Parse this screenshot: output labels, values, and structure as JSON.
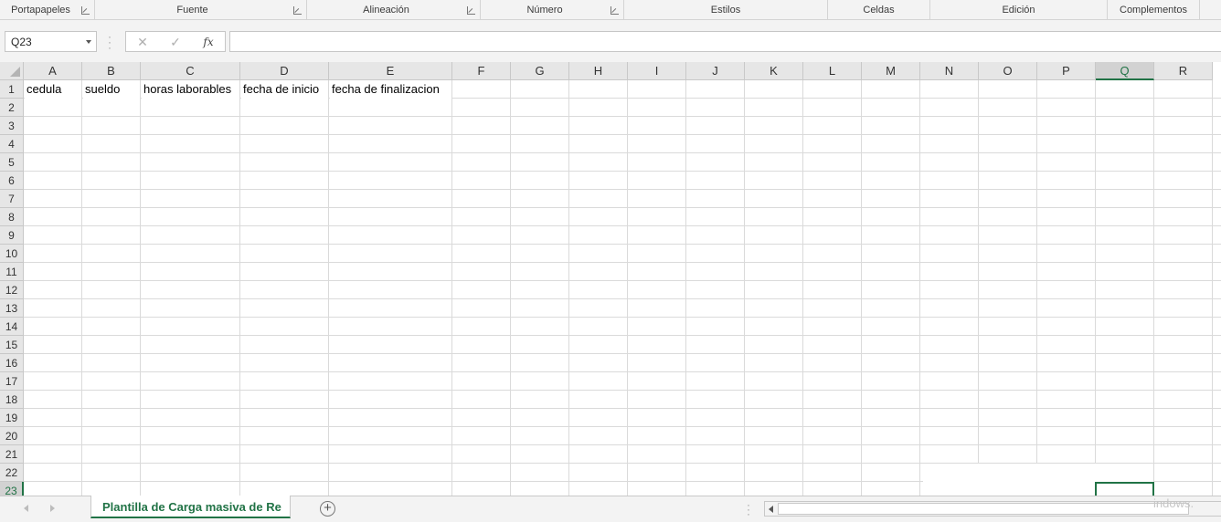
{
  "ribbon": {
    "groups": [
      {
        "label": "Portapapeles",
        "launcher": true
      },
      {
        "label": "Fuente",
        "launcher": true
      },
      {
        "label": "Alineación",
        "launcher": true
      },
      {
        "label": "Número",
        "launcher": true
      },
      {
        "label": "Estilos",
        "launcher": false
      },
      {
        "label": "Celdas",
        "launcher": false
      },
      {
        "label": "Edición",
        "launcher": false
      },
      {
        "label": "Complementos",
        "launcher": false
      }
    ]
  },
  "formula_bar": {
    "name_box": "Q23",
    "cancel_icon": "✕",
    "enter_icon": "✓",
    "fx_label": "fx",
    "formula": ""
  },
  "grid": {
    "columns": [
      "A",
      "B",
      "C",
      "D",
      "E",
      "F",
      "G",
      "H",
      "I",
      "J",
      "K",
      "L",
      "M",
      "N",
      "O",
      "P",
      "Q",
      "R"
    ],
    "rows": [
      "1",
      "2",
      "3",
      "4",
      "5",
      "6",
      "7",
      "8",
      "9",
      "10",
      "11",
      "12",
      "13",
      "14",
      "15",
      "16",
      "17",
      "18",
      "19",
      "20",
      "21",
      "22",
      "23"
    ],
    "selected_column": "Q",
    "selected_row": "23",
    "row1_cells": [
      "cedula",
      "sueldo",
      "horas laborables",
      "fecha de inicio",
      "fecha de finalizacion"
    ]
  },
  "sheet_tabs": {
    "active_tab": "Plantilla de Carga masiva de Re",
    "add_sheet_icon": "+"
  },
  "watermark_fragment": "indows."
}
